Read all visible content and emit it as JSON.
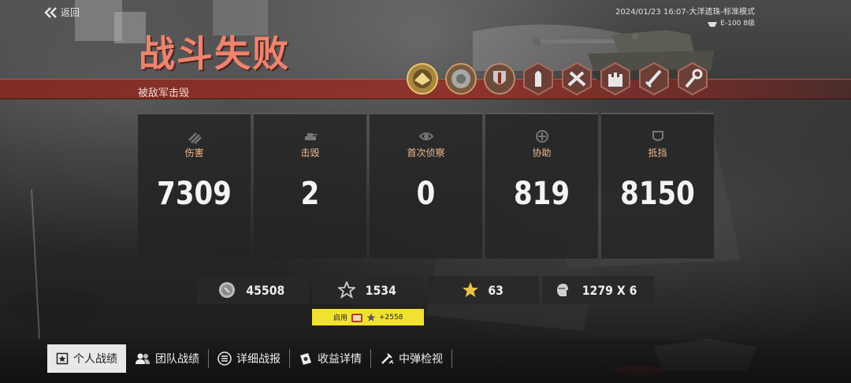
{
  "nav": {
    "back_label": "返回"
  },
  "match_info": {
    "datetime_map": "2024/01/23 16:07-大洋遗珠-标准模式",
    "tank_name": "E-100 8级"
  },
  "result": {
    "title": "战斗失败",
    "subtitle": "被敌军击毁"
  },
  "medals": [
    {
      "icon": "gold-crest-medal-icon"
    },
    {
      "icon": "bronze-crest-medal-icon"
    },
    {
      "icon": "shield-crest-medal-icon"
    },
    {
      "icon": "shell-badge-icon"
    },
    {
      "icon": "crossed-guns-badge-icon"
    },
    {
      "icon": "fortress-badge-icon"
    },
    {
      "icon": "sword-badge-icon"
    },
    {
      "icon": "wrench-badge-icon"
    }
  ],
  "stats": [
    {
      "label": "伤害",
      "value": "7309",
      "icon": "damage-icon"
    },
    {
      "label": "击毁",
      "value": "2",
      "icon": "tank-kill-icon"
    },
    {
      "label": "首次侦察",
      "value": "0",
      "icon": "eye-icon"
    },
    {
      "label": "协助",
      "value": "819",
      "icon": "assist-icon"
    },
    {
      "label": "抵挡",
      "value": "8150",
      "icon": "block-icon"
    }
  ],
  "rewards": [
    {
      "value": "45508",
      "icon": "silver-coin-icon"
    },
    {
      "value": "1534",
      "icon": "experience-star-icon"
    },
    {
      "value": "63",
      "icon": "gold-star-icon"
    },
    {
      "value": "1279 X 6",
      "icon": "crew-helmet-icon"
    }
  ],
  "booster": {
    "label": "启用",
    "bonus": "+2558"
  },
  "tabs": [
    {
      "label": "个人战绩",
      "active": true,
      "icon": "personal-record-icon"
    },
    {
      "label": "团队战绩",
      "active": false,
      "icon": "team-icon"
    },
    {
      "label": "详细战报",
      "active": false,
      "icon": "list-icon"
    },
    {
      "label": "收益详情",
      "active": false,
      "icon": "earnings-icon"
    },
    {
      "label": "中弹检视",
      "active": false,
      "icon": "hit-inspect-icon"
    }
  ],
  "colors": {
    "accent_red": "#8f2e26",
    "title": "#f0836e",
    "stat_label": "#f0b98a",
    "booster": "#f1e232"
  }
}
